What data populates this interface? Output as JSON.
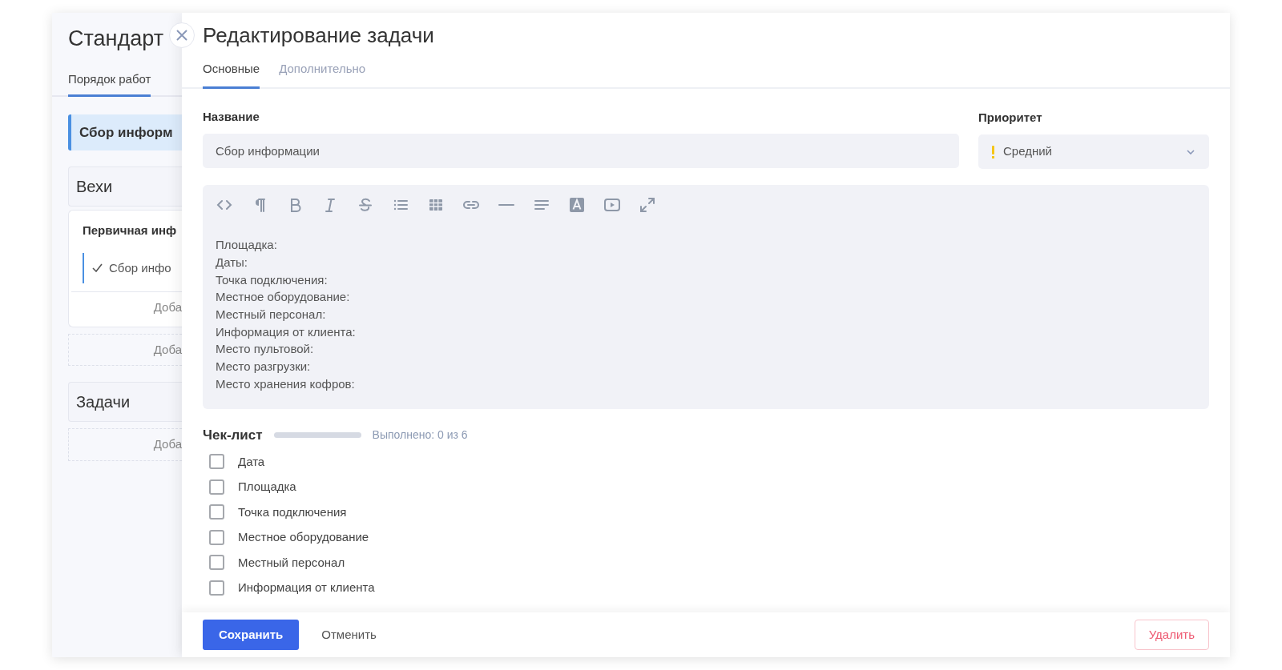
{
  "background_panel": {
    "title": "Стандарт",
    "tabs": [
      {
        "label": "Порядок работ",
        "selected": true
      }
    ],
    "active_stage": "Сбор информ",
    "sections": [
      {
        "title": "Вехи",
        "milestones": [
          {
            "title": "Первичная инф",
            "tasks": [
              {
                "label": "Сбор инфо",
                "done": true
              }
            ],
            "add_label": "Доба"
          }
        ],
        "add_label": "Доба"
      },
      {
        "title": "Задачи",
        "add_label": "Доба"
      }
    ]
  },
  "dialog": {
    "title": "Редактирование задачи",
    "tabs": [
      {
        "label": "Основные",
        "selected": true
      },
      {
        "label": "Дополнительно",
        "selected": false
      }
    ],
    "name_field": {
      "label": "Название",
      "value": "Сбор информации"
    },
    "priority": {
      "label": "Приоритет",
      "value": "Средний"
    },
    "editor_lines": [
      "Площадка:",
      "Даты:",
      "Точка подключения:",
      "Местное оборудование:",
      "Местный персонал:",
      "Информация от клиента:",
      "Место пультовой:",
      "Место разгрузки:",
      "Место хранения кофров:"
    ],
    "checklist": {
      "title": "Чек-лист",
      "level": 0,
      "progress_text": "Выполнено: 0 из 6",
      "items": [
        {
          "label": "Дата",
          "checked": false
        },
        {
          "label": "Площадка",
          "checked": false
        },
        {
          "label": "Точка подключения",
          "checked": false
        },
        {
          "label": "Местное оборудование",
          "checked": false
        },
        {
          "label": "Местный персонал",
          "checked": false
        },
        {
          "label": "Информация от клиента",
          "checked": false
        }
      ]
    },
    "footer": {
      "save": "Сохранить",
      "cancel": "Отменить",
      "delete": "Удалить"
    }
  }
}
